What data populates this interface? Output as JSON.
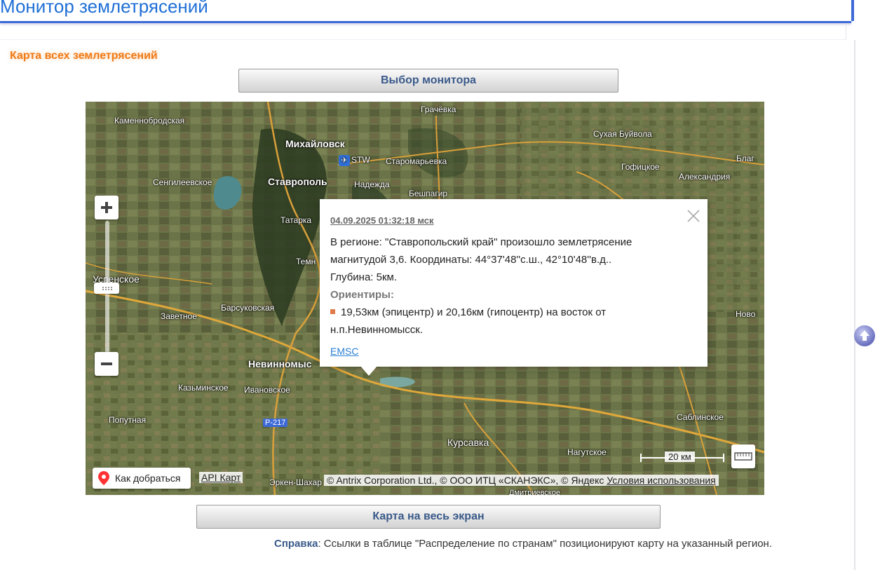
{
  "header": {
    "title": "Монитор землетрясений"
  },
  "section": {
    "title": "Карта всех землетрясений"
  },
  "buttons": {
    "monitor": "Выбор монитора",
    "fullscreen": "Карта на весь экран"
  },
  "map": {
    "places": [
      {
        "name": "Каменнобродская",
        "big": false
      },
      {
        "name": "Грачёвка",
        "big": false
      },
      {
        "name": "Михайловск",
        "big": true
      },
      {
        "name": "STW",
        "big": false
      },
      {
        "name": "Старомарьевка",
        "big": false
      },
      {
        "name": "Сухая Буйвола",
        "big": false
      },
      {
        "name": "Сенгилеевское",
        "big": false
      },
      {
        "name": "Ставрополь",
        "big": true
      },
      {
        "name": "Надежда",
        "big": false
      },
      {
        "name": "Гофицкое",
        "big": false
      },
      {
        "name": "Александрия",
        "big": false
      },
      {
        "name": "Бешпагир",
        "big": false
      },
      {
        "name": "Татарка",
        "big": false
      },
      {
        "name": "Темн",
        "big": false
      },
      {
        "name": "Успенское",
        "big": false
      },
      {
        "name": "Барсуковская",
        "big": false
      },
      {
        "name": "Заветное",
        "big": false
      },
      {
        "name": "Невинномыс",
        "big": true
      },
      {
        "name": "Казьминское",
        "big": false
      },
      {
        "name": "Ивановское",
        "big": false
      },
      {
        "name": "Попутная",
        "big": false
      },
      {
        "name": "Р-217",
        "big": false
      },
      {
        "name": "Курсавка",
        "big": false
      },
      {
        "name": "Нагутское",
        "big": false
      },
      {
        "name": "Саблинское",
        "big": false
      },
      {
        "name": "Эркен-Шахар",
        "big": false
      },
      {
        "name": "Ново",
        "big": false
      },
      {
        "name": "Благ",
        "big": false
      },
      {
        "name": "Дмитриевское",
        "big": false
      }
    ],
    "popup": {
      "date": "04.09.2025 01:32:18 мск",
      "line1": "В регионе: \"Ставропольский край\" произошло землетрясение",
      "line2": "магнитудой 3,6. Координаты: 44°37'48''с.ш., 42°10'48''в.д..",
      "line3": "Глубина: 5км.",
      "orient_label": "Ориентиры:",
      "orient_line1": "19,53км (эпицентр) и 20,16км (гипоцентр) на восток от",
      "orient_line2": "н.п.Невинномысск.",
      "source": "EMSC"
    },
    "route_label": "Как добраться",
    "api_label": "API Карт",
    "copyright": "© Antrix Corporation Ltd., © ООО ИТЦ «СКАНЭКС», © Яндекс",
    "terms": "Условия использования",
    "scale_label": "20 км"
  },
  "help": {
    "label": "Справка",
    "text": ": Ссылки в таблице \"Распределение по странам\" позиционируют карту на указанный регион."
  }
}
